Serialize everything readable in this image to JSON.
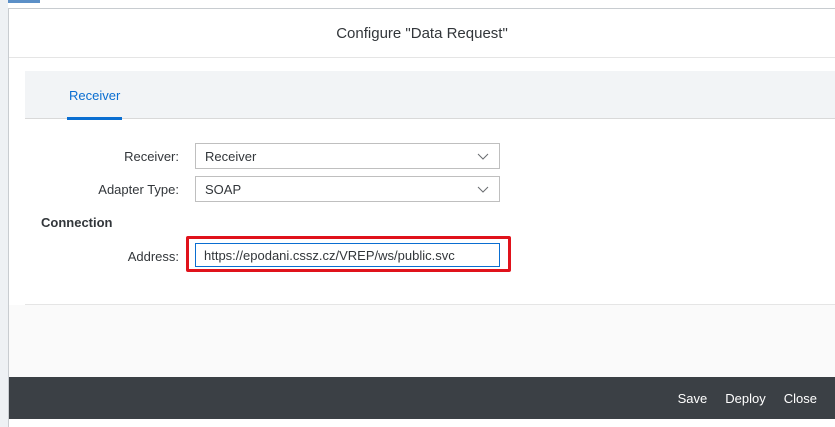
{
  "dialog": {
    "title": "Configure \"Data Request\""
  },
  "tabs": [
    {
      "label": "Receiver",
      "active": true
    }
  ],
  "form": {
    "receiver": {
      "label": "Receiver:",
      "value": "Receiver"
    },
    "adapter_type": {
      "label": "Adapter Type:",
      "value": "SOAP"
    },
    "connection_section": "Connection",
    "address": {
      "label": "Address:",
      "value": "https://epodani.cssz.cz/VREP/ws/public.svc"
    }
  },
  "footer": {
    "save_label": "Save",
    "deploy_label": "Deploy",
    "close_label": "Close"
  },
  "colors": {
    "accent": "#0a6ed1",
    "highlight": "#e0121b",
    "footer_bg": "#3b4045"
  },
  "icons": {
    "dropdown": "chevron-down-icon"
  }
}
